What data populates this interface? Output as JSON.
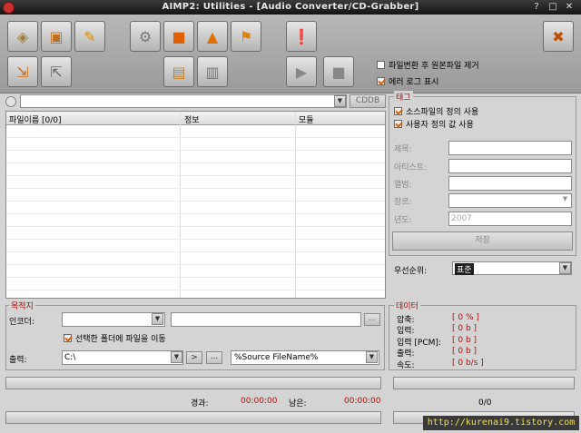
{
  "window": {
    "title": "AIMP2: Utilities - [Audio Converter/CD-Grabber]"
  },
  "toolbar": {
    "options": {
      "delete_source": "파일변환 후 원본파일 제거",
      "show_error_log": "에러 로그 표시"
    }
  },
  "source": {
    "cddb_label": "CDDB",
    "path_value": ""
  },
  "filelist": {
    "columns": [
      "파일이름 [0/0]",
      "정보",
      "모듈"
    ]
  },
  "tag": {
    "title": "태그",
    "use_source_tags": "소스파일의 정의 사용",
    "use_user_tags": "사용자 정의 값 사용",
    "fields": {
      "title": "제목:",
      "artist": "아티스트:",
      "album": "앨범:",
      "genre": "장르:",
      "year": "년도:"
    },
    "year_placeholder": "2007",
    "save_label": "저장"
  },
  "priority": {
    "label": "우선순위:",
    "value": "표준"
  },
  "destination": {
    "title": "목적지",
    "encoder_label": "인코더:",
    "move_to_folder": "선택한 폴더에 파일을 이동",
    "output_label": "출력:",
    "output_path": "C:\\",
    "filename_pattern": "%Source FileName%",
    "arrow_label": ">",
    "browse_label": "..."
  },
  "data": {
    "title": "데이터",
    "rows": [
      {
        "label": "압축:",
        "value": "[ 0 % ]"
      },
      {
        "label": "입력:",
        "value": "[ 0 b ]"
      },
      {
        "label": "입력 [PCM]:",
        "value": "[ 0 b ]"
      },
      {
        "label": "출력:",
        "value": "[ 0 b ]"
      },
      {
        "label": "속도:",
        "value": "[ 0 b/s ]"
      }
    ]
  },
  "status": {
    "elapsed_label": "경과:",
    "elapsed_value": "00:00:00",
    "remaining_label": "남은:",
    "remaining_value": "00:00:00",
    "count": "0/0"
  },
  "watermark": "http://kurenai9.tistory.com",
  "colors": {
    "accent": "#d06010",
    "danger": "#b01010"
  }
}
